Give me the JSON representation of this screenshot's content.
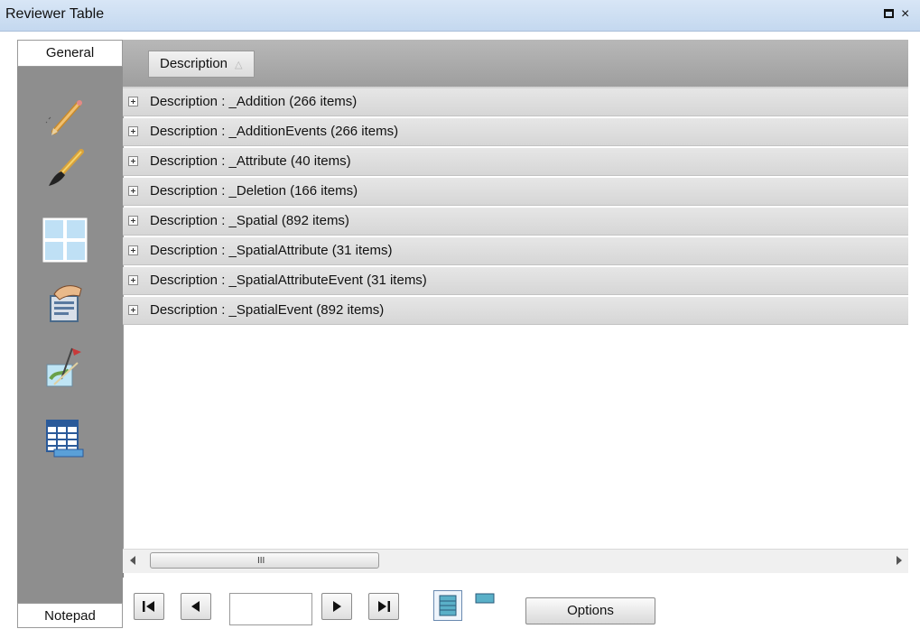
{
  "window": {
    "title": "Reviewer Table",
    "maximize_icon": "maximize-icon",
    "close_icon": "close-icon"
  },
  "sidebar": {
    "top_tab": "General",
    "bottom_tab": "Notepad",
    "tools": [
      {
        "icon": "pencil-icon"
      },
      {
        "icon": "paintbrush-icon"
      },
      {
        "icon": "grid-window-icon"
      },
      {
        "icon": "hand-document-icon"
      },
      {
        "icon": "map-flag-icon"
      },
      {
        "icon": "table-icon"
      }
    ]
  },
  "grid": {
    "group_column": "Description",
    "sort_icon": "sort-ascending-icon",
    "rows": [
      "Description : _Addition (266 items)",
      "Description : _AdditionEvents (266 items)",
      "Description : _Attribute (40 items)",
      "Description : _Deletion (166 items)",
      "Description : _Spatial (892 items)",
      "Description : _SpatialAttribute (31 items)",
      "Description : _SpatialAttributeEvent (31 items)",
      "Description : _SpatialEvent (892 items)"
    ],
    "scroll_grip": "III"
  },
  "navigation": {
    "first_icon": "first-page-icon",
    "prev_icon": "previous-page-icon",
    "page_value": "",
    "next_icon": "next-page-icon",
    "last_icon": "last-page-icon",
    "view_icons": [
      "list-view-icon",
      "single-record-view-icon"
    ],
    "options_label": "Options"
  },
  "colors": {
    "titlebar": "#c4d8ef",
    "sidebar": "#8e8e8e",
    "header": "#a8a8a8",
    "row": "#dedede"
  }
}
